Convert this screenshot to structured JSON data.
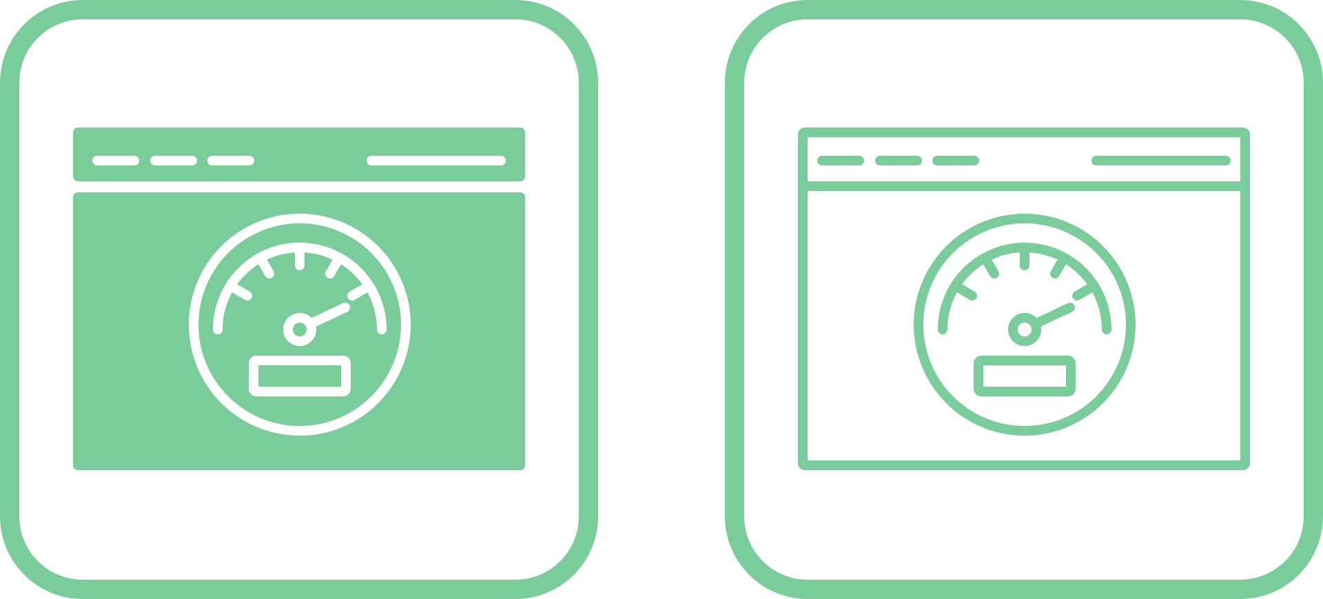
{
  "theme": {
    "accent": "#7ACC9B",
    "background": "#FFFFFF"
  },
  "icons": [
    {
      "name": "browser-speedometer-icon",
      "style": "filled"
    },
    {
      "name": "browser-speedometer-icon",
      "style": "outline"
    }
  ]
}
